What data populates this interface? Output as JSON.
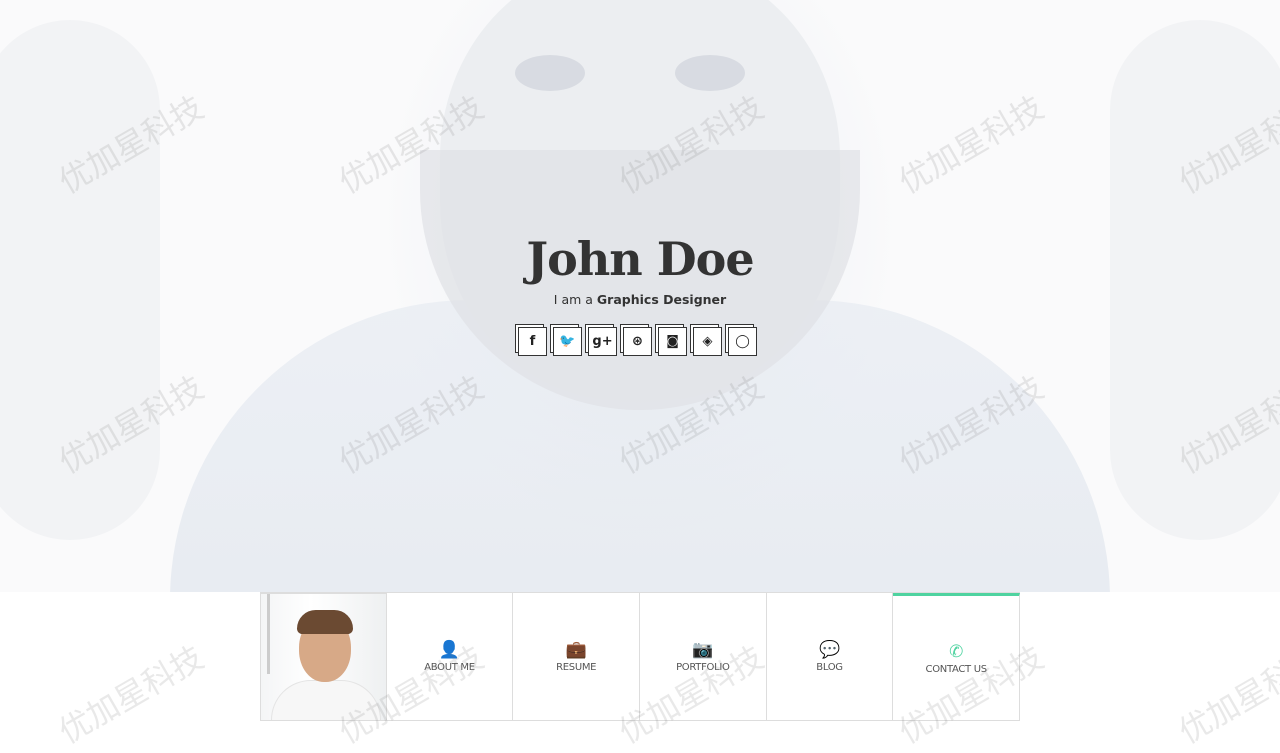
{
  "hero": {
    "name": "John Doe",
    "tagline_prefix": "I am a",
    "tagline_role": "Graphics Designer",
    "social": [
      {
        "icon": "facebook-icon",
        "glyph": "f"
      },
      {
        "icon": "twitter-icon",
        "glyph": "🐦"
      },
      {
        "icon": "google-plus-icon",
        "glyph": "g+"
      },
      {
        "icon": "dribbble-icon",
        "glyph": "⊛"
      },
      {
        "icon": "instagram-icon",
        "glyph": "◙"
      },
      {
        "icon": "codepen-icon",
        "glyph": "◈"
      },
      {
        "icon": "github-icon",
        "glyph": "◯"
      }
    ]
  },
  "nav": {
    "items": [
      {
        "label": "ABOUT ME",
        "icon": "user-icon",
        "glyph": "👤"
      },
      {
        "label": "RESUME",
        "icon": "briefcase-icon",
        "glyph": "💼"
      },
      {
        "label": "PORTFOLIO",
        "icon": "camera-icon",
        "glyph": "📷"
      },
      {
        "label": "BLOG",
        "icon": "comments-icon",
        "glyph": "💬"
      },
      {
        "label": "CONTACT US",
        "icon": "phone-icon",
        "glyph": "✆"
      }
    ],
    "active": "CONTACT US"
  },
  "colors": {
    "accent": "#4fd3a0",
    "text": "#333333"
  },
  "watermark": "优加星科技"
}
